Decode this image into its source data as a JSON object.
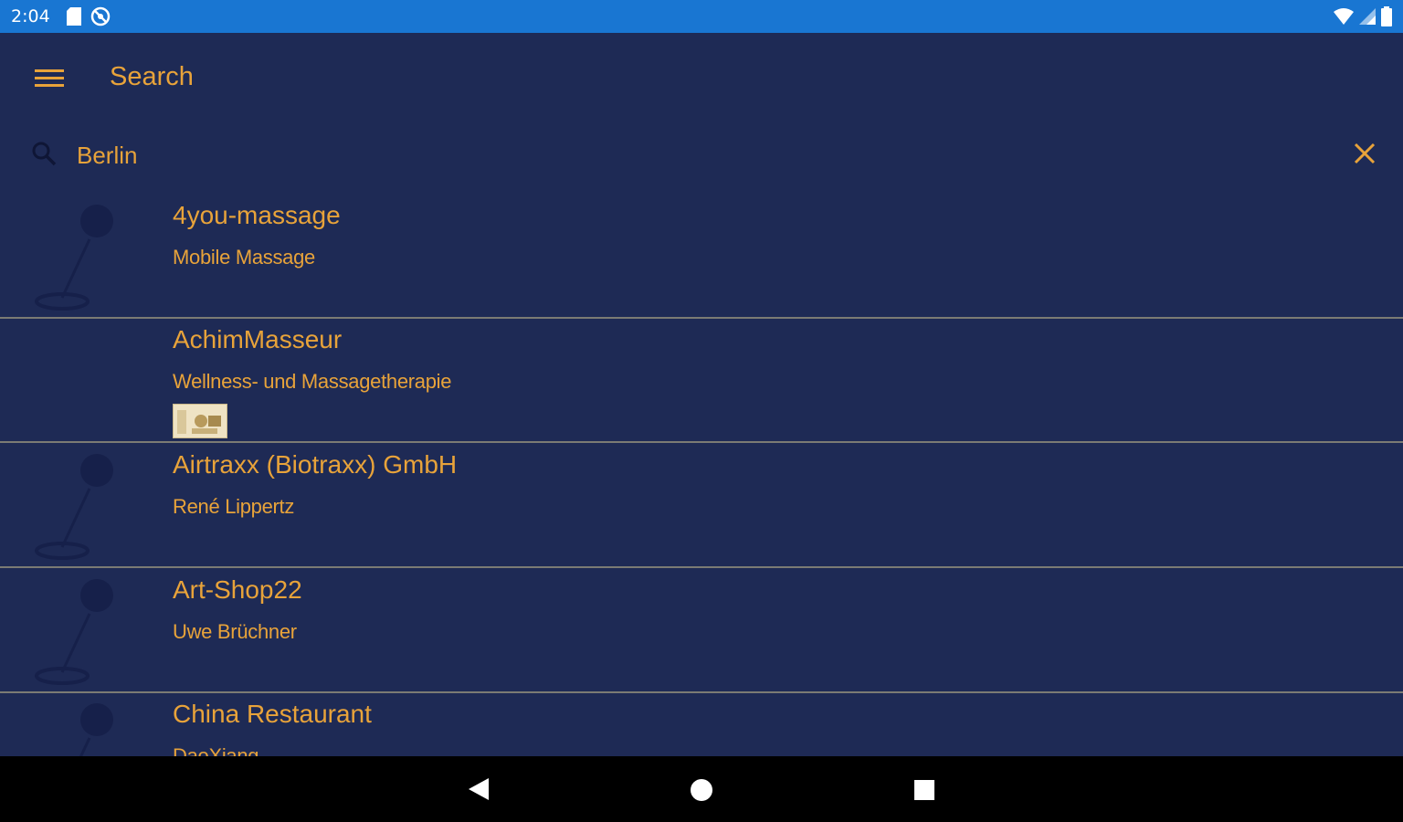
{
  "status_bar": {
    "time": "2:04",
    "left_icons": [
      "sd-card-icon",
      "no-data-icon"
    ],
    "right_icons": [
      "wifi-icon",
      "signal-icon",
      "battery-icon"
    ],
    "background": "#1976d2"
  },
  "app_bar": {
    "title": "Search",
    "menu_icon": "hamburger-menu-icon"
  },
  "search": {
    "value": "Berlin",
    "placeholder": "",
    "search_icon": "search-icon",
    "clear_icon": "close-icon"
  },
  "results": [
    {
      "title": "4you-massage",
      "subtitle": "Mobile Massage",
      "thumbnail": "pin-icon"
    },
    {
      "title": "AchimMasseur",
      "subtitle": "Wellness- und Massagetherapie",
      "thumbnail": "none",
      "photo": "business-photo"
    },
    {
      "title": "Airtraxx (Biotraxx) GmbH",
      "subtitle": "René Lippertz",
      "thumbnail": "pin-icon"
    },
    {
      "title": "Art-Shop22",
      "subtitle": "Uwe Brüchner",
      "thumbnail": "pin-icon"
    },
    {
      "title": "China Restaurant",
      "subtitle": "DaoXiang",
      "thumbnail": "pin-icon"
    }
  ],
  "colors": {
    "background": "#1e2a55",
    "accent": "#e8a33a",
    "divider": "#8c8a7a",
    "nav_bar": "#000000"
  },
  "nav_bar": {
    "buttons": [
      "back-icon",
      "home-icon",
      "recents-icon"
    ]
  }
}
